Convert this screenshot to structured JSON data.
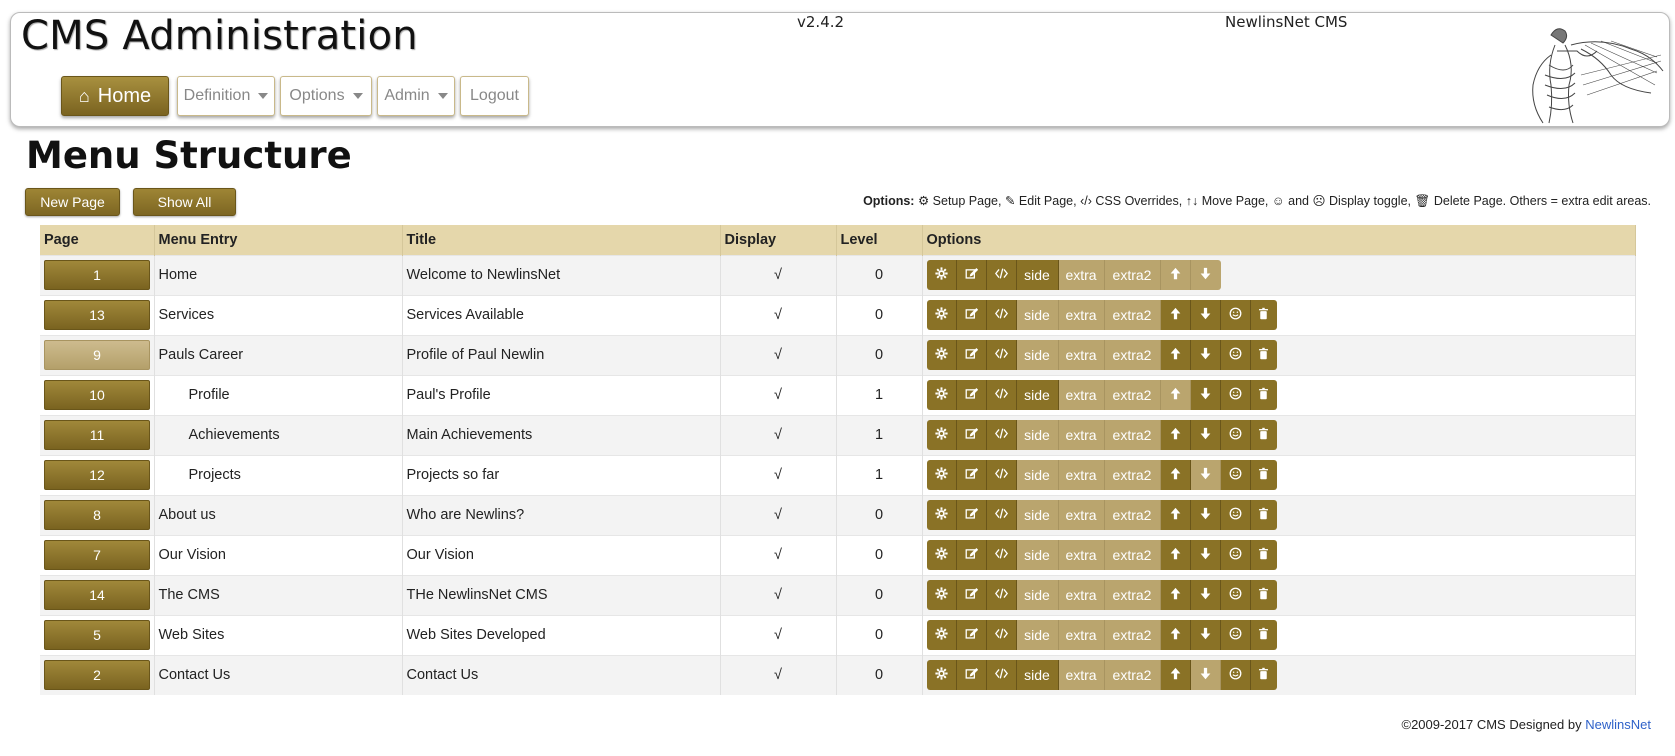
{
  "header": {
    "app_title": "CMS Administration",
    "version": "v2.4.2",
    "site_name": "NewlinsNet CMS",
    "logo_icon": "fisherman-casting-net-illustration"
  },
  "nav": {
    "home": "Home",
    "definition": "Definition",
    "options": "Options",
    "admin": "Admin",
    "logout": "Logout"
  },
  "page": {
    "title": "Menu Structure",
    "new_page": "New Page",
    "show_all": "Show All"
  },
  "legend": {
    "label": "Options:",
    "setup": "Setup Page,",
    "edit": "Edit Page,",
    "css": "CSS Overrides,",
    "move": "Move Page,",
    "and": "and",
    "display": "Display toggle,",
    "delete": "Delete Page. Others = extra edit areas."
  },
  "table": {
    "columns": [
      "Page",
      "Menu Entry",
      "Title",
      "Display",
      "Level",
      "Options"
    ],
    "option_labels": {
      "side": "side",
      "extra": "extra",
      "extra2": "extra2"
    },
    "rows": [
      {
        "page": "1",
        "entry": "Home",
        "title": "Welcome to NewlinsNet",
        "display": "√",
        "level": "0",
        "indent": false,
        "pale": false
      },
      {
        "page": "13",
        "entry": "Services",
        "title": "Services Available",
        "display": "√",
        "level": "0",
        "indent": false,
        "pale": false
      },
      {
        "page": "9",
        "entry": "Pauls Career",
        "title": "Profile of Paul Newlin",
        "display": "√",
        "level": "0",
        "indent": false,
        "pale": true
      },
      {
        "page": "10",
        "entry": "Profile",
        "title": "Paul's Profile",
        "display": "√",
        "level": "1",
        "indent": true,
        "pale": false
      },
      {
        "page": "11",
        "entry": "Achievements",
        "title": "Main Achievements",
        "display": "√",
        "level": "1",
        "indent": true,
        "pale": false
      },
      {
        "page": "12",
        "entry": "Projects",
        "title": "Projects so far",
        "display": "√",
        "level": "1",
        "indent": true,
        "pale": false
      },
      {
        "page": "8",
        "entry": "About us",
        "title": "Who are Newlins?",
        "display": "√",
        "level": "0",
        "indent": false,
        "pale": false
      },
      {
        "page": "7",
        "entry": "Our Vision",
        "title": "Our Vision",
        "display": "√",
        "level": "0",
        "indent": false,
        "pale": false
      },
      {
        "page": "14",
        "entry": "The CMS",
        "title": "THe NewlinsNet CMS",
        "display": "√",
        "level": "0",
        "indent": false,
        "pale": false
      },
      {
        "page": "5",
        "entry": "Web Sites",
        "title": "Web Sites Developed",
        "display": "√",
        "level": "0",
        "indent": false,
        "pale": false
      },
      {
        "page": "2",
        "entry": "Contact Us",
        "title": "Contact Us",
        "display": "√",
        "level": "0",
        "indent": false,
        "pale": false
      }
    ]
  },
  "footer": {
    "text": "©2009-2017 CMS Designed by",
    "link": "NewlinsNet"
  },
  "colors": {
    "brand": "#8a7226",
    "brand_dim": "#baa56e",
    "table_header": "#e5d7ab",
    "link": "#2f62c9"
  }
}
